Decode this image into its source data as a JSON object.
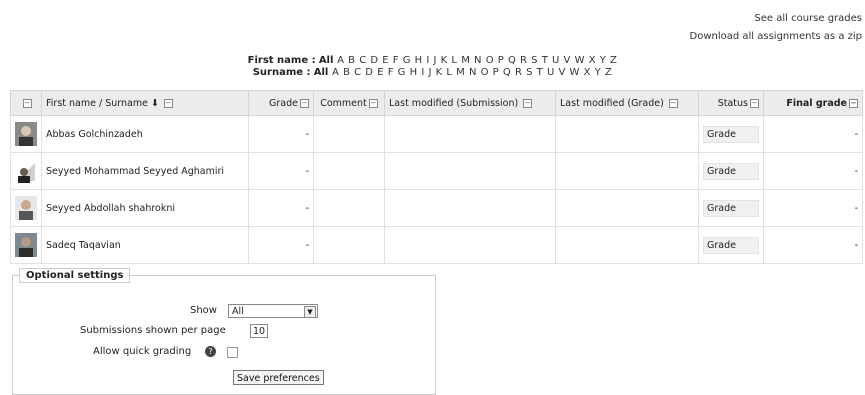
{
  "top_links": {
    "see_all": "See all course grades",
    "download": "Download all assignments as a zip"
  },
  "initials": {
    "first_label": "First name :",
    "last_label": "Surname :",
    "all": "All",
    "letters": [
      "A",
      "B",
      "C",
      "D",
      "E",
      "F",
      "G",
      "H",
      "I",
      "J",
      "K",
      "L",
      "M",
      "N",
      "O",
      "P",
      "Q",
      "R",
      "S",
      "T",
      "U",
      "V",
      "W",
      "X",
      "Y",
      "Z"
    ]
  },
  "table": {
    "headers": {
      "select": "",
      "name": "First name / Surname",
      "grade": "Grade",
      "comment": "Comment",
      "last_sub": "Last modified (Submission)",
      "last_grade": "Last modified (Grade)",
      "status": "Status",
      "final": "Final grade"
    },
    "rows": [
      {
        "name": "Abbas Golchinzadeh",
        "grade": "-",
        "comment": "",
        "sub": "",
        "lastgrade": "",
        "status": "Grade",
        "final": "-"
      },
      {
        "name": "Seyyed Mohammad Seyyed Aghamiri",
        "grade": "-",
        "comment": "",
        "sub": "",
        "lastgrade": "",
        "status": "Grade",
        "final": "-"
      },
      {
        "name": "Seyyed Abdollah shahrokni",
        "grade": "-",
        "comment": "",
        "sub": "",
        "lastgrade": "",
        "status": "Grade",
        "final": "-"
      },
      {
        "name": "Sadeq Taqavian",
        "grade": "-",
        "comment": "",
        "sub": "",
        "lastgrade": "",
        "status": "Grade",
        "final": "-"
      }
    ]
  },
  "options": {
    "legend": "Optional settings",
    "show_label": "Show",
    "show_value": "All",
    "per_page_label": "Submissions shown per page",
    "per_page_value": "10",
    "quick_label": "Allow quick grading",
    "save": "Save preferences"
  }
}
